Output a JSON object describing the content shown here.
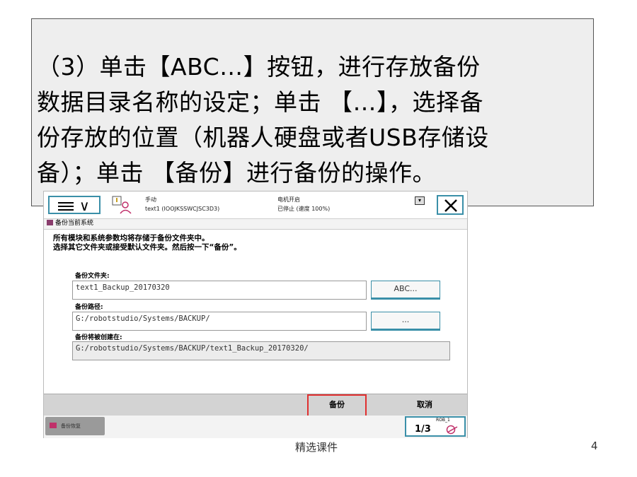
{
  "slide": {
    "instruction_lines": [
      "（3）单击【ABC…】按钮，进行存放备份",
      "数据目录名称的设定；单击 【…】，选择备",
      "份存放的位置（机器人硬盘或者USB存储设",
      "备）；单击 【备份】进行备份的操作。"
    ],
    "footer_text": "精选课件",
    "page_number": "4"
  },
  "ui": {
    "status": {
      "mode": "手动",
      "system": "text1 (IOOJKSSWCJSC3D3)",
      "motors": "电机开启",
      "state": "已停止 (速度 100%)"
    },
    "window_title": "备份当前系统",
    "message_lines": [
      "所有模块和系统参数均将存储于备份文件夹中。",
      "选择其它文件夹或接受默认文件夹。然后按一下“备份”。"
    ],
    "folder_label": "备份文件夹:",
    "folder_value": "text1_Backup_20170320",
    "abc_button": "ABC...",
    "path_label": "备份路径:",
    "path_value": "G:/robotstudio/Systems/BACKUP/",
    "browse_button": "...",
    "created_label": "备份将被创建在:",
    "created_value": "G:/robotstudio/Systems/BACKUP/text1_Backup_20170320/",
    "backup_button": "备份",
    "cancel_button": "取消",
    "task_tab": "备份恢复",
    "speed_unit": "ROB_1",
    "speed_fraction": "1/3",
    "highlight_color": "#e03030"
  }
}
